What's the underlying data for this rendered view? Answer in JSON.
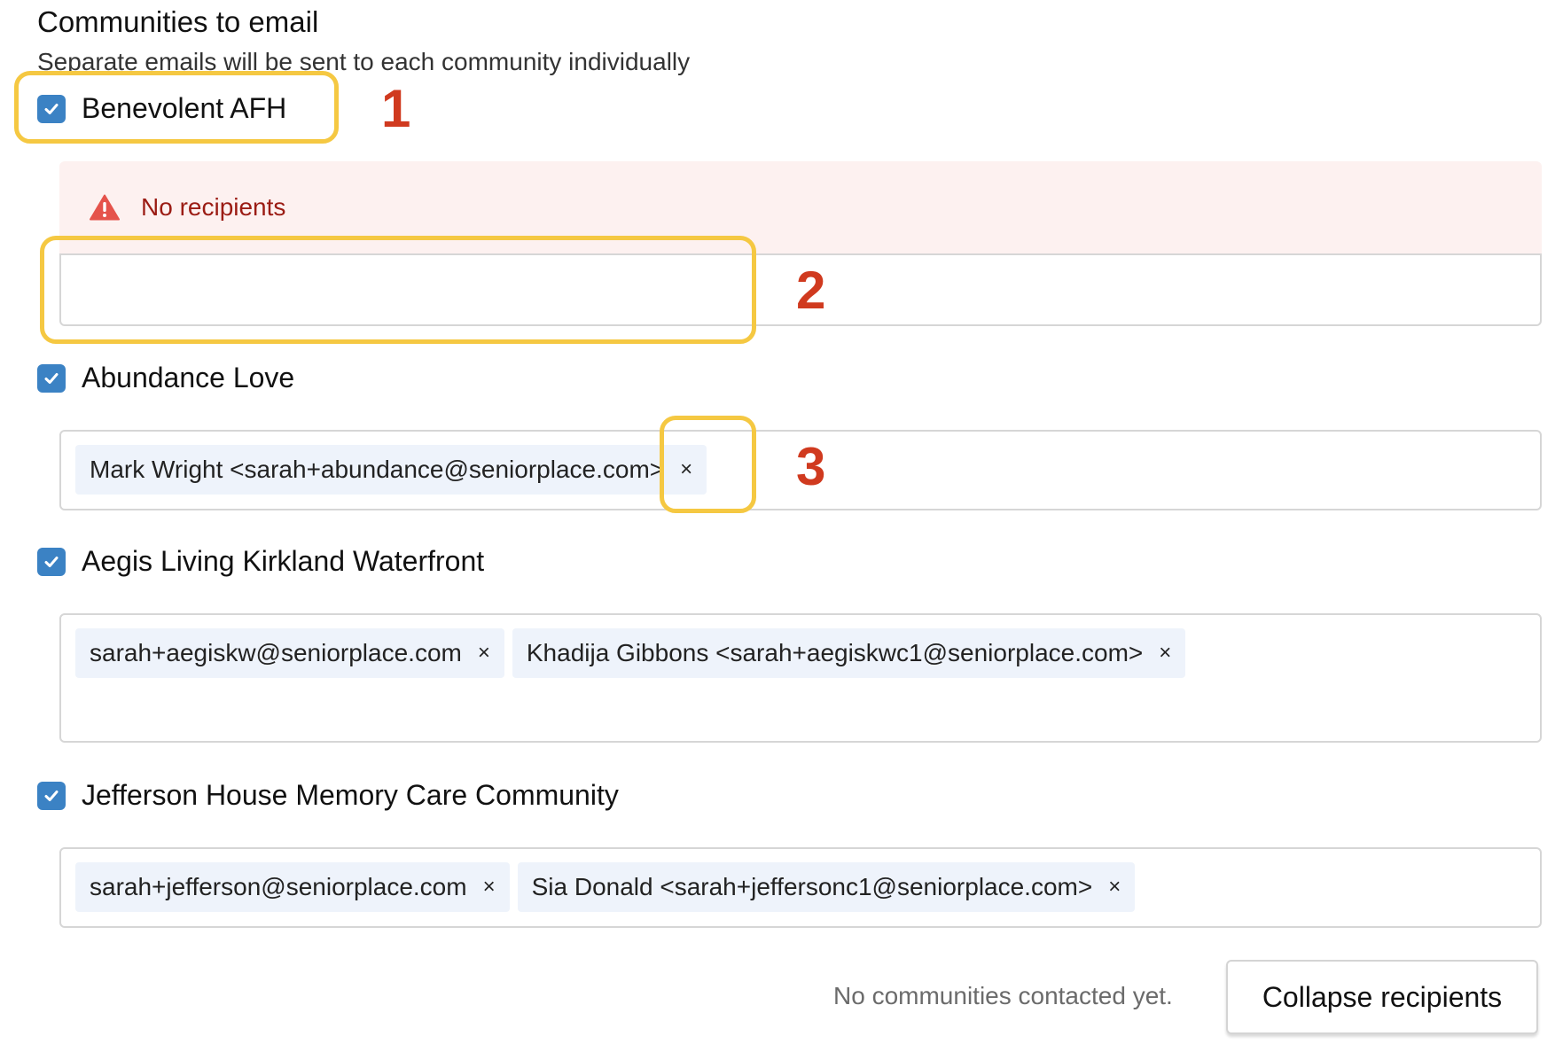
{
  "header": {
    "title": "Communities to email",
    "subtitle": "Separate emails will be sent to each community individually"
  },
  "communities": [
    {
      "name": "Benevolent AFH",
      "checked": true,
      "alert": "No recipients",
      "recipients": []
    },
    {
      "name": "Abundance Love",
      "checked": true,
      "recipients": [
        {
          "label": "Mark Wright <sarah+abundance@seniorplace.com>",
          "remove": "×"
        }
      ]
    },
    {
      "name": "Aegis Living Kirkland Waterfront",
      "checked": true,
      "recipients": [
        {
          "label": "sarah+aegiskw@seniorplace.com",
          "remove": "×"
        },
        {
          "label": "Khadija Gibbons <sarah+aegiskwc1@seniorplace.com>",
          "remove": "×"
        }
      ]
    },
    {
      "name": "Jefferson House Memory Care Community",
      "checked": true,
      "recipients": [
        {
          "label": "sarah+jefferson@seniorplace.com",
          "remove": "×"
        },
        {
          "label": "Sia Donald <sarah+jeffersonc1@seniorplace.com>",
          "remove": "×"
        }
      ]
    }
  ],
  "annotations": [
    "1",
    "2",
    "3"
  ],
  "footer": {
    "status": "No communities contacted yet.",
    "collapse_label": "Collapse recipients"
  },
  "colors": {
    "checkbox": "#3b82c4",
    "alert_bg": "#fdf1f0",
    "alert_text": "#9b1c14",
    "chip_bg": "#eef3fb",
    "annotation_box": "#f5c842",
    "annotation_number": "#d03a1f"
  },
  "icons": {
    "checkbox": "check-icon",
    "alert": "warning-triangle-icon",
    "remove": "close-icon"
  }
}
